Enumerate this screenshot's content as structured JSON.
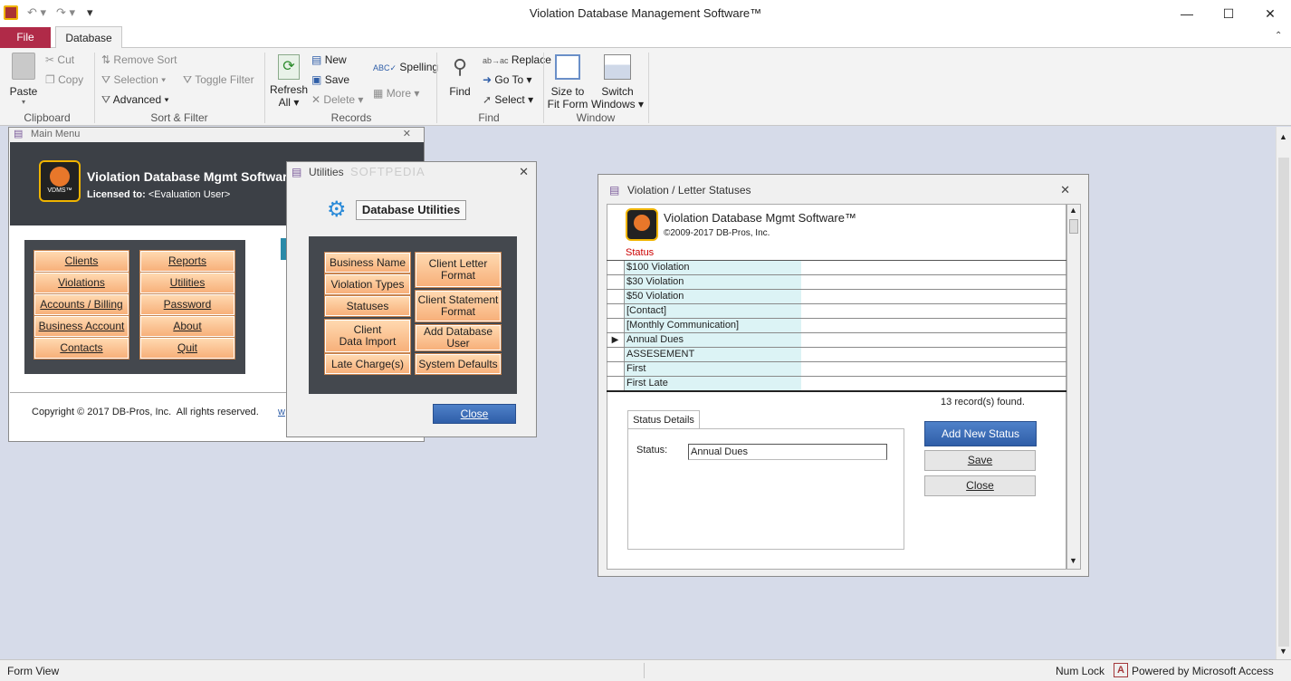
{
  "app": {
    "title": "Violation Database Management Software™",
    "status_left": "Form View",
    "status_num": "Num Lock",
    "status_powered": "Powered by Microsoft Access"
  },
  "tabs": {
    "file": "File",
    "database": "Database"
  },
  "ribbon": {
    "paste": "Paste",
    "cut": "Cut",
    "copy": "Copy",
    "remove_sort": "Remove Sort",
    "selection": "Selection",
    "toggle_filter": "Toggle Filter",
    "advanced": "Advanced",
    "refresh": "Refresh",
    "refresh2": "All",
    "new": "New",
    "save": "Save",
    "delete": "Delete",
    "spelling": "Spelling",
    "more": "More",
    "find": "Find",
    "replace": "Replace",
    "goto": "Go To",
    "select": "Select",
    "size1": "Size to",
    "size2": "Fit Form",
    "switch1": "Switch",
    "switch2": "Windows",
    "groups": {
      "clipboard": "Clipboard",
      "sortfilter": "Sort & Filter",
      "records": "Records",
      "find": "Find",
      "window": "Window"
    }
  },
  "main_menu": {
    "title": "Main Menu",
    "app_name": "Violation Database Mgmt Software™",
    "licensed_label": "Licensed to:",
    "licensed_value": "<Evaluation User>",
    "logo_text": "VDMS™",
    "buttons_left": [
      "Clients",
      "Violations",
      "Accounts / Billing",
      "Business Account",
      "Contacts"
    ],
    "buttons_right": [
      "Reports",
      "Utilities",
      "Password",
      "About",
      "Quit"
    ],
    "copyright": "Copyright © 2017 DB-Pros, Inc.  All rights reserved.",
    "link": "w"
  },
  "utilities": {
    "title": "Utilities",
    "heading": "Database Utilities",
    "watermark": "SOFTPEDIA",
    "left": [
      "Business Name",
      "Violation Types",
      "Statuses",
      "Client\nData Import",
      "Late Charge(s)"
    ],
    "right": [
      "Client Letter\nFormat",
      "Client Statement\nFormat",
      "Add Database\nUser",
      "System Defaults"
    ],
    "close": "Close"
  },
  "statuses": {
    "title": "Violation / Letter Statuses",
    "app_name": "Violation Database Mgmt Software™",
    "copyright": "©2009-2017 DB-Pros, Inc.",
    "column": "Status",
    "rows": [
      "$100 Violation",
      "$30 Violation",
      "$50 Violation",
      "[Contact]",
      "[Monthly Communication]",
      "Annual Dues",
      "ASSESEMENT",
      "First",
      "First Late"
    ],
    "selected_index": 5,
    "count": "13",
    "count_suffix": "record(s) found.",
    "details_tab": "Status Details",
    "status_label": "Status:",
    "status_value": "Annual Dues",
    "add_btn": "Add New Status",
    "save_btn": "Save",
    "close_btn": "Close"
  },
  "colors": {
    "file_tab": "#b02a48",
    "accent_orange": "#f7b07a",
    "blue_button": "#2f5ea8",
    "grid_cell": "#dcf3f5",
    "main_header": "#3c4046"
  }
}
